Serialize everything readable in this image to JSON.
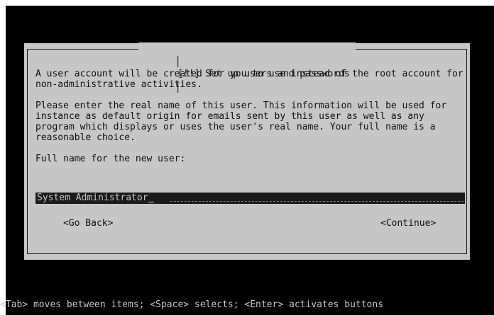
{
  "dialog": {
    "title": "[!!] Set up users and passwords",
    "paragraph1": "A user account will be created for you to use instead of the root account for non-administrative activities.",
    "paragraph2": "Please enter the real name of this user. This information will be used for instance as default origin for emails sent by this user as well as any program which displays or uses the user's real name. Your full name is a reasonable choice.",
    "field_label": "Full name for the new user:",
    "field_value": "System Administrator",
    "go_back_label": "<Go Back>",
    "continue_label": "<Continue>"
  },
  "help_line": "<Tab> moves between items; <Space> selects; <Enter> activates buttons",
  "colors": {
    "screen_bg": "#000000",
    "dialog_bg": "#c6c6c6",
    "input_bg": "#1b1b1b",
    "text_dark": "#111111",
    "text_light": "#c6c6c6"
  }
}
